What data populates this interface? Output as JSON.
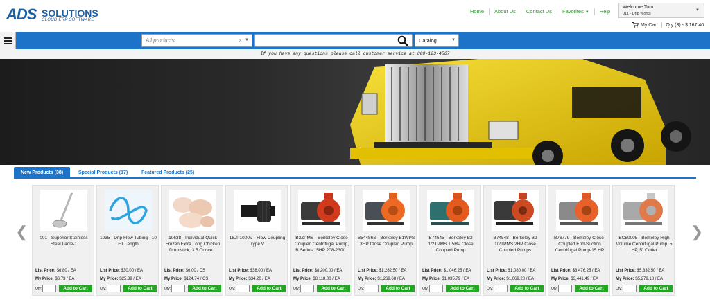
{
  "brand": {
    "logo_main": "ADS",
    "logo_sub": "SOLUTIONS",
    "tagline": "CLOUD ERP SOFTWARE",
    "color": "#1a5fa8"
  },
  "topnav": {
    "items": [
      "Home",
      "About Us",
      "Contact Us",
      "Favorites",
      "Help"
    ],
    "color": "#2e9a2e"
  },
  "account": {
    "welcome": "Welcome Tom",
    "company": "011 - Drip Works"
  },
  "cart": {
    "label": "My Cart",
    "summary": "Qty (3) - $ 167.40"
  },
  "searchbar": {
    "category_placeholder": "All products",
    "search_value": "",
    "catalog_selected": "Catalog",
    "bar_color": "#1d73c8"
  },
  "notice": "If you have any questions please call customer service at 800-123-4567",
  "tabs": [
    "New Products (38)",
    "Special Products (17)",
    "Featured Products (25)"
  ],
  "labels": {
    "list_price": "List Price:",
    "my_price": "My Price:",
    "qty": "Qty:",
    "add_to_cart": "Add to Cart"
  },
  "products": [
    {
      "title": "001 - Superior Stainless Steel Ladle-1",
      "list_price": "$6.80 / EA",
      "my_price": "$6.73 / EA",
      "icon": "ladle"
    },
    {
      "title": "1035 - Drip Flow Tubing - 10 FT Length",
      "list_price": "$30.00 / EA",
      "my_price": "$25.39 / EA",
      "icon": "tubing"
    },
    {
      "title": "10638 - Individual Quick Frozen Extra Long Chicken Drumstick, 3.5 Ounce...",
      "list_price": "$6.00 / CS",
      "my_price": "$124.74 / CS",
      "icon": "chicken"
    },
    {
      "title": "18JP1000V - Flow Coupling Type V",
      "list_price": "$38.00 / EA",
      "my_price": "$34.20 / EA",
      "icon": "coupling"
    },
    {
      "title": "B3ZPMS - Berkeley Close Coupled Centrifugal Pump, B Series 15HP 208-230/...",
      "list_price": "$8,200.00 / EA",
      "my_price": "$8,118.00 / EA",
      "icon": "pump-red"
    },
    {
      "title": "B54486S - Berkeley B1WPS 3HP Close Coupled Pump",
      "list_price": "$1,282.50 / EA",
      "my_price": "$1,269.68 / EA",
      "icon": "pump-orange"
    },
    {
      "title": "B74545 - Berkeley B2 1/2TPMS 1.5HP Close Coupled Pump",
      "list_price": "$1,046.25 / EA",
      "my_price": "$1,035.79 / EA",
      "icon": "pump-teal"
    },
    {
      "title": "B74548 - Berkeley B2 1/2TPMS 2HP Close Coupled Pumps",
      "list_price": "$1,080.00 / EA",
      "my_price": "$1,069.20 / EA",
      "icon": "pump-dark"
    },
    {
      "title": "B76779 - Berkeley Close-Coupled End-Suction Centrifugal Pump-15 HP",
      "list_price": "$3,476.25 / EA",
      "my_price": "$3,441.49 / EA",
      "icon": "pump-grey"
    },
    {
      "title": "BC50005 - Berkeley High Volume Centrifugal Pump, 5 HP, 5\" Outlet",
      "list_price": "$5,332.50 / EA",
      "my_price": "$5,279.18 / EA",
      "icon": "pump-silver"
    }
  ]
}
